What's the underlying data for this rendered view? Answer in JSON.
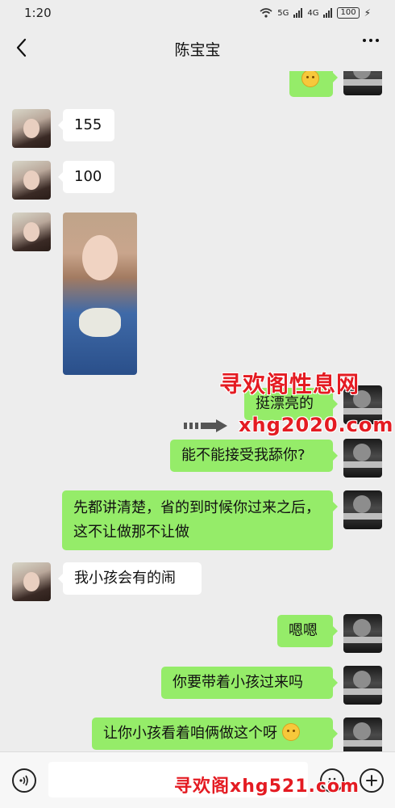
{
  "status_bar": {
    "time": "1:20",
    "net_labels": [
      "5G",
      "4G"
    ],
    "battery": "100"
  },
  "header": {
    "title": "陈宝宝"
  },
  "messages": [
    {
      "side": "right",
      "type": "emoji"
    },
    {
      "side": "left",
      "type": "text",
      "text": "155"
    },
    {
      "side": "left",
      "type": "text",
      "text": "100"
    },
    {
      "side": "left",
      "type": "image"
    },
    {
      "side": "right",
      "type": "text",
      "text": "挺漂亮的"
    },
    {
      "side": "right",
      "type": "text",
      "text": "能不能接受我舔你?"
    },
    {
      "side": "right",
      "type": "text",
      "text": "先都讲清楚，省的到时候你过来之后，这不让做那不让做"
    },
    {
      "side": "left",
      "type": "text",
      "text": "我小孩会有的闹"
    },
    {
      "side": "right",
      "type": "text",
      "text": "嗯嗯"
    },
    {
      "side": "right",
      "type": "text",
      "text": "你要带着小孩过来吗"
    },
    {
      "side": "right",
      "type": "text",
      "text": "让你小孩看着咱俩做这个呀"
    }
  ],
  "watermarks": {
    "top_line1": "寻欢阁性息网",
    "top_line2": "xhg2020.com",
    "bottom": "寻欢阁xhg521.com",
    "color": "#e41b22"
  },
  "colors": {
    "background": "#ededed",
    "bubble_right": "#95ec69",
    "bubble_left": "#ffffff"
  },
  "icons": {
    "back": "chevron-left-icon",
    "more": "more-dots-icon",
    "voice": "voice-icon",
    "emoji": "emoji-icon",
    "add": "add-icon"
  }
}
